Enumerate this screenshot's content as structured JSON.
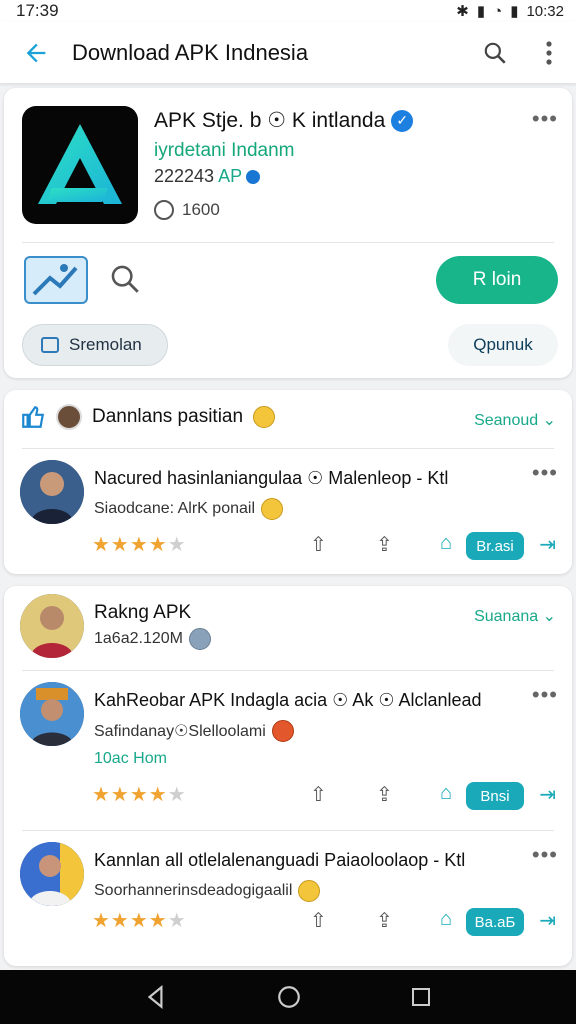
{
  "status": {
    "time": "17:39",
    "clock_right": "10:32",
    "icons": [
      "bluetooth-icon",
      "signal-icon",
      "wifi-icon",
      "battery-icon"
    ]
  },
  "appbar": {
    "title": "Download APK Indnesia"
  },
  "app": {
    "name": "APK Stje. b ☉ K intlanda",
    "developer": "iyrdetani Indanm",
    "downloads": "222243",
    "downloads_tag": "AP",
    "size": "1600",
    "install_label": "R loin",
    "chip_left": "Sremolan",
    "chip_right": "Qpunuk"
  },
  "section1": {
    "title": "Dannlans pasitian",
    "see_more": "Seanoud",
    "post": {
      "title": "Nacured hasinlaniangulaa ☉ Malenleop - Ktl",
      "subtitle": "Siaodcane: AlrK ponail",
      "tag": "Br.аsi",
      "rating": 4
    }
  },
  "section2": {
    "title": "Rakng APK",
    "subtitle": "1а6а2.120M",
    "see_more": "Suanana",
    "posts": [
      {
        "title": "KahReobar APK Indagla acia ☉ Ak ☉ Alclanlead",
        "subtitle": "Safindanay☉Slelloolami",
        "link": "10ac Hom",
        "tag": "Bnsi",
        "rating": 4
      },
      {
        "title": "Kannlan all otlelalenanguadi Paiaoloolaop - Ktl",
        "subtitle": "Soorhannerinsdeadogigaalil",
        "tag": "Bа.аБ",
        "rating": 4
      }
    ]
  },
  "colors": {
    "accent": "#18b58a",
    "link": "#18a88a",
    "tag": "#19a9b8",
    "star": "#f0a330",
    "verified": "#1d7fe0"
  }
}
